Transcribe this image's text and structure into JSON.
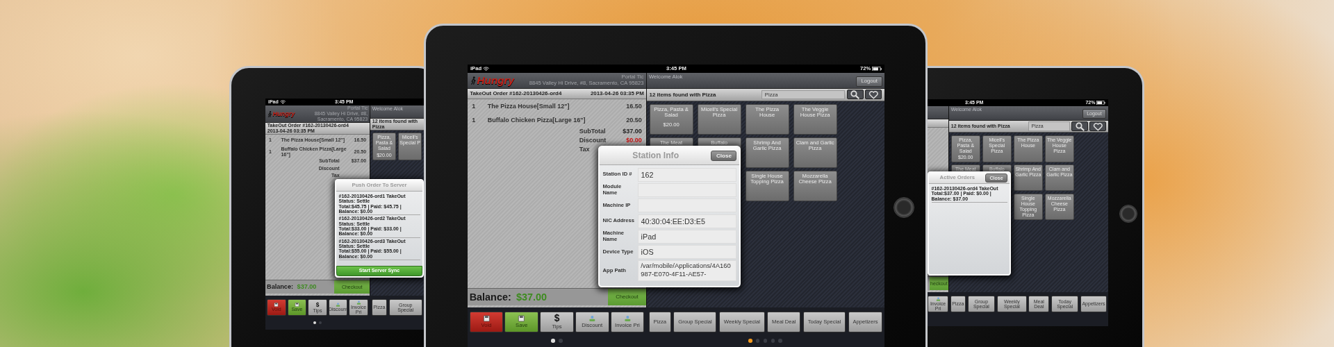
{
  "ipads": [
    {
      "status_bar": {
        "carrier": "iPad",
        "time": "3:45 PM"
      },
      "order_panel": {
        "logo": "Hungry",
        "store_name": "Portal Tic",
        "address": "8845 Valley Hi Drive, #8, Sacramento, CA 95823",
        "title": "TakeOut Order #162-20130426-ord4",
        "date": "2013-04-26  03:35 PM",
        "items": [
          {
            "qty": "1",
            "name": "The Pizza House[Small 12\"]",
            "price": "16.50"
          },
          {
            "qty": "1",
            "name": "Buffalo Chicken Pizza[Large 16\"]",
            "price": "20.50"
          }
        ],
        "totals": [
          {
            "label": "SubTotal",
            "value": "$37.00"
          },
          {
            "label": "Discount"
          },
          {
            "label": "Tax"
          }
        ],
        "balance_label": "Balance:",
        "balance": "$37.00",
        "checkout": "Checkout"
      },
      "menu_panel": {
        "welcome": "Welcome Alok",
        "result_count": "12 items found with Pizza",
        "tile_rows": [
          [
            {
              "label": "Pizza, Pasta & Salad",
              "price": "$20.00"
            },
            {
              "label": "Micell's Special P"
            }
          ]
        ]
      },
      "actions": [
        {
          "kind": "void",
          "label": "Void"
        },
        {
          "kind": "save",
          "label": "Save"
        },
        {
          "kind": "tips",
          "glyph": "$",
          "label": "Tips"
        },
        {
          "kind": "discount",
          "label": "Discount"
        },
        {
          "kind": "invoice",
          "label": "Invoice Pri"
        }
      ],
      "categories": [
        "Pizza",
        "Group Special"
      ],
      "action_pager": [
        {
          "selected": true
        },
        {
          "selected": false
        }
      ],
      "popup": {
        "kind": "list",
        "title": "Push Order To Server",
        "entries": [
          {
            "title": "#162-20130426-ord1 TakeOut Status: Settle",
            "summary": "Total:$45.75 | Paid: $45.75 | Balance: $0.00"
          },
          {
            "title": "#162-20130426-ord2 TakeOut Status: Settle",
            "summary": "Total:$33.00 | Paid: $33.00 | Balance: $0.00"
          },
          {
            "title": "#162-20130426-ord3 TakeOut Status: Settle",
            "summary": "Total:$55.00 | Paid: $55.00 | Balance: $0.00"
          }
        ],
        "action": "Start Server Sync"
      }
    },
    {
      "status_bar": {
        "carrier": "iPad",
        "time": "3:45 PM",
        "battery": "72%"
      },
      "order_panel": {
        "logo": "Hungry",
        "store_name": "Portal Tic",
        "address": "8845 Valley Hi Drive, #8, Sacramento, CA 95823",
        "title": "TakeOut Order #162-20130426-ord4",
        "date": "2013-04-26  03:35 PM",
        "items": [
          {
            "qty": "1",
            "name": "The Pizza House[Small 12\"]",
            "price": "16.50"
          },
          {
            "qty": "1",
            "name": "Buffalo Chicken Pizza[Large 16\"]",
            "price": "20.50"
          }
        ],
        "totals": [
          {
            "label": "SubTotal",
            "value": "$37.00",
            "color": "#222222"
          },
          {
            "label": "Discount",
            "value": "$0.00",
            "color": "#cc1111"
          },
          {
            "label": "Tax"
          }
        ],
        "balance_label": "Balance:",
        "balance": "$37.00",
        "checkout": "Checkout"
      },
      "menu_panel": {
        "welcome": "Welcome Alok",
        "logout": "Logout",
        "result_count": "12 items found with Pizza",
        "search": {
          "value": "Pizza"
        },
        "tile_rows": [
          [
            {
              "label": "Pizza, Pasta & Salad",
              "price": "$20.00"
            },
            {
              "label": "Micell's Special Pizza"
            },
            {
              "label": "The Pizza House"
            },
            {
              "label": "The Veggie House Pizza"
            }
          ],
          [
            {
              "label": "The Meat"
            },
            {
              "label": "Buffalo"
            },
            {
              "label": "Shrimp And Garlic Pizza"
            },
            {
              "label": "Clam and Garlic Pizza"
            }
          ],
          [
            {
              "label": "Single House Topping Pizza"
            },
            {
              "label": "Mozzarella Cheese Pizza"
            }
          ]
        ]
      },
      "actions": [
        {
          "kind": "void",
          "label": "Void"
        },
        {
          "kind": "save",
          "label": "Save"
        },
        {
          "kind": "tips",
          "glyph": "$",
          "label": "Tips"
        },
        {
          "kind": "discount",
          "label": "Discount"
        },
        {
          "kind": "invoice",
          "label": "Invoice Pri"
        }
      ],
      "categories": [
        "Pizza",
        "Group Special",
        "Weekly Special",
        "Meal Deal",
        "Today Special",
        "Appetizers"
      ],
      "action_pager": [
        {
          "selected": true
        },
        {
          "selected": false
        }
      ],
      "category_pager": [
        {
          "selected": true
        },
        {
          "selected": false
        },
        {
          "selected": false
        },
        {
          "selected": false
        },
        {
          "selected": false
        }
      ],
      "popup": {
        "kind": "form",
        "title": "Station Info",
        "close": "Close",
        "fields": [
          {
            "kind": "text",
            "label": "Station ID #",
            "value": "162"
          },
          {
            "kind": "text",
            "label": "Module Name"
          },
          {
            "kind": "text",
            "label": "Machine IP"
          },
          {
            "kind": "text",
            "label": "NIC Address",
            "value": "40:30:04:EE:D3:E5"
          },
          {
            "kind": "text",
            "label": "Machine Name",
            "value": "iPad"
          },
          {
            "kind": "text",
            "label": "Device Type",
            "value": "iOS"
          },
          {
            "kind": "multiline",
            "label": "App Path",
            "value": "/var/mobile/Applications/4A160987-E070-4F11-AE57-"
          }
        ]
      }
    },
    {
      "status_bar": {
        "time": "3:45 PM",
        "battery": "72%"
      },
      "order_panel": {
        "checkout": "heckout"
      },
      "menu_panel": {
        "welcome": "Welcome Alok",
        "logout": "Logout",
        "result_count": "12 items found with Pizza",
        "search": {
          "value": "Pizza"
        },
        "tile_rows": [
          [
            {
              "label": "Pizza, Pasta & Salad",
              "price": "$20.00"
            },
            {
              "label": "Micell's Special Pizza"
            },
            {
              "label": "The Pizza House"
            },
            {
              "label": "The Veggie House Pizza"
            }
          ],
          [
            {
              "label": "The Meat"
            },
            {
              "label": "Buffalo"
            },
            {
              "label": "Shrimp And Garlic Pizza"
            },
            {
              "label": "Clam and Garlic Pizza"
            }
          ],
          [
            {
              "label": "Single House Topping Pizza"
            },
            {
              "label": "Mozzarella Cheese Pizza"
            }
          ]
        ]
      },
      "actions": [
        {
          "kind": "invoice",
          "label": "Invoice Pri"
        }
      ],
      "categories": [
        "Pizza",
        "Group Special",
        "Weekly Special",
        "Meal Deal",
        "Today Special",
        "Appetizers"
      ],
      "popup": {
        "kind": "list",
        "title": "Active Orders",
        "close": "Close",
        "entries": [
          {
            "title": "#162-20130426-ord4 TakeOut",
            "summary": "Total:$37.00 | Paid: $0.00 | Balance: $37.00"
          }
        ]
      }
    }
  ]
}
